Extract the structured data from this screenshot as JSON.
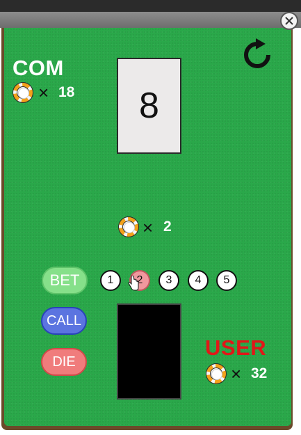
{
  "window": {
    "close_icon": "close-icon"
  },
  "refresh_icon": "refresh-icon",
  "com": {
    "label": "COM",
    "chip_icon": "chip-icon",
    "times": "×",
    "chips": "18"
  },
  "com_card": {
    "value": "8"
  },
  "pot": {
    "chip_icon": "chip-icon",
    "times": "×",
    "chips": "2"
  },
  "controls": {
    "bet_label": "BET",
    "call_label": "CALL",
    "die_label": "DIE",
    "bet_amounts": [
      "1",
      "2",
      "3",
      "4",
      "5"
    ],
    "selected_amount": "2"
  },
  "user": {
    "label": "USER",
    "chip_icon": "chip-icon",
    "times": "×",
    "chips": "32"
  },
  "colors": {
    "felt": "#2aa84a",
    "user_label": "#e01818",
    "bet_button": "#86e08a",
    "call_button": "#5b74e0",
    "die_button": "#f07c7c",
    "selected_amount": "#f0989e"
  }
}
